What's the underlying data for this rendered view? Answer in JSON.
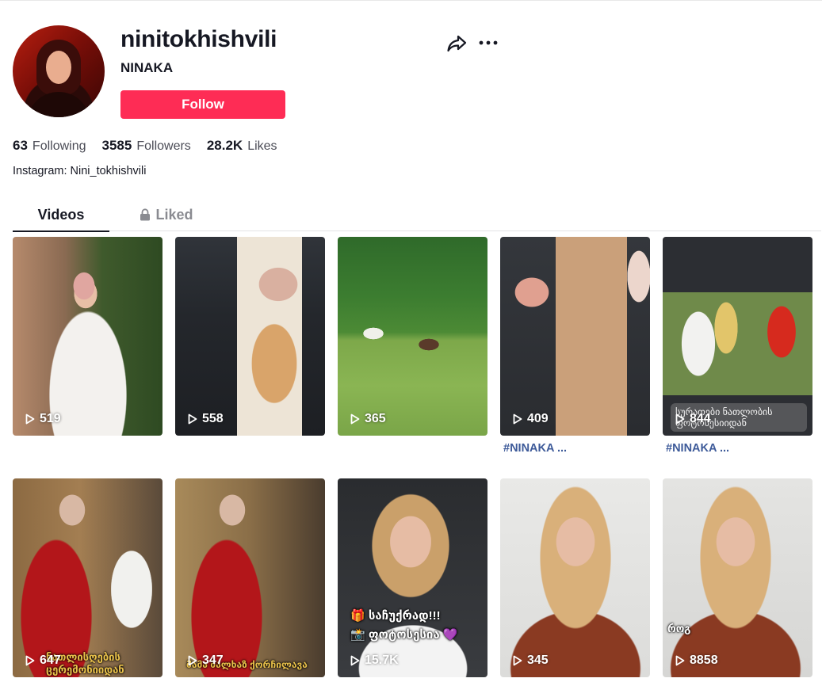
{
  "profile": {
    "username": "ninitokhishvili",
    "nickname": "NINAKA",
    "follow_label": "Follow",
    "bio": "Instagram: Nini_tokhishvili"
  },
  "stats": {
    "following": {
      "value": "63",
      "label": "Following"
    },
    "followers": {
      "value": "3585",
      "label": "Followers"
    },
    "likes": {
      "value": "28.2K",
      "label": "Likes"
    }
  },
  "tabs": {
    "videos": "Videos",
    "liked": "Liked"
  },
  "icons": {
    "share": "share-icon",
    "more": "more-icon",
    "lock": "lock-icon",
    "play": "play-icon"
  },
  "colors": {
    "accent": "#fe2c55",
    "caption": "#3d5a99"
  },
  "videos": [
    {
      "views": "519"
    },
    {
      "views": "558"
    },
    {
      "views": "365"
    },
    {
      "views": "409",
      "caption": "#NINAKA ..."
    },
    {
      "views": "844",
      "caption": "#NINAKA ...",
      "overlay": "სურათები ნათლობის ფოტოსესიიდან"
    },
    {
      "views": "647",
      "overlay": "ნათლისღების ცერემონიიდან"
    },
    {
      "views": "347",
      "overlay": "მამა მალხაზ ქორჩილავა"
    },
    {
      "views": "15.7K",
      "overlay_line1": "🎁 საჩუქრად!!!",
      "overlay_line2": "📸 ფოტოსესია 💜"
    },
    {
      "views": "345"
    },
    {
      "views": "8858",
      "overlay": "როგ"
    }
  ]
}
